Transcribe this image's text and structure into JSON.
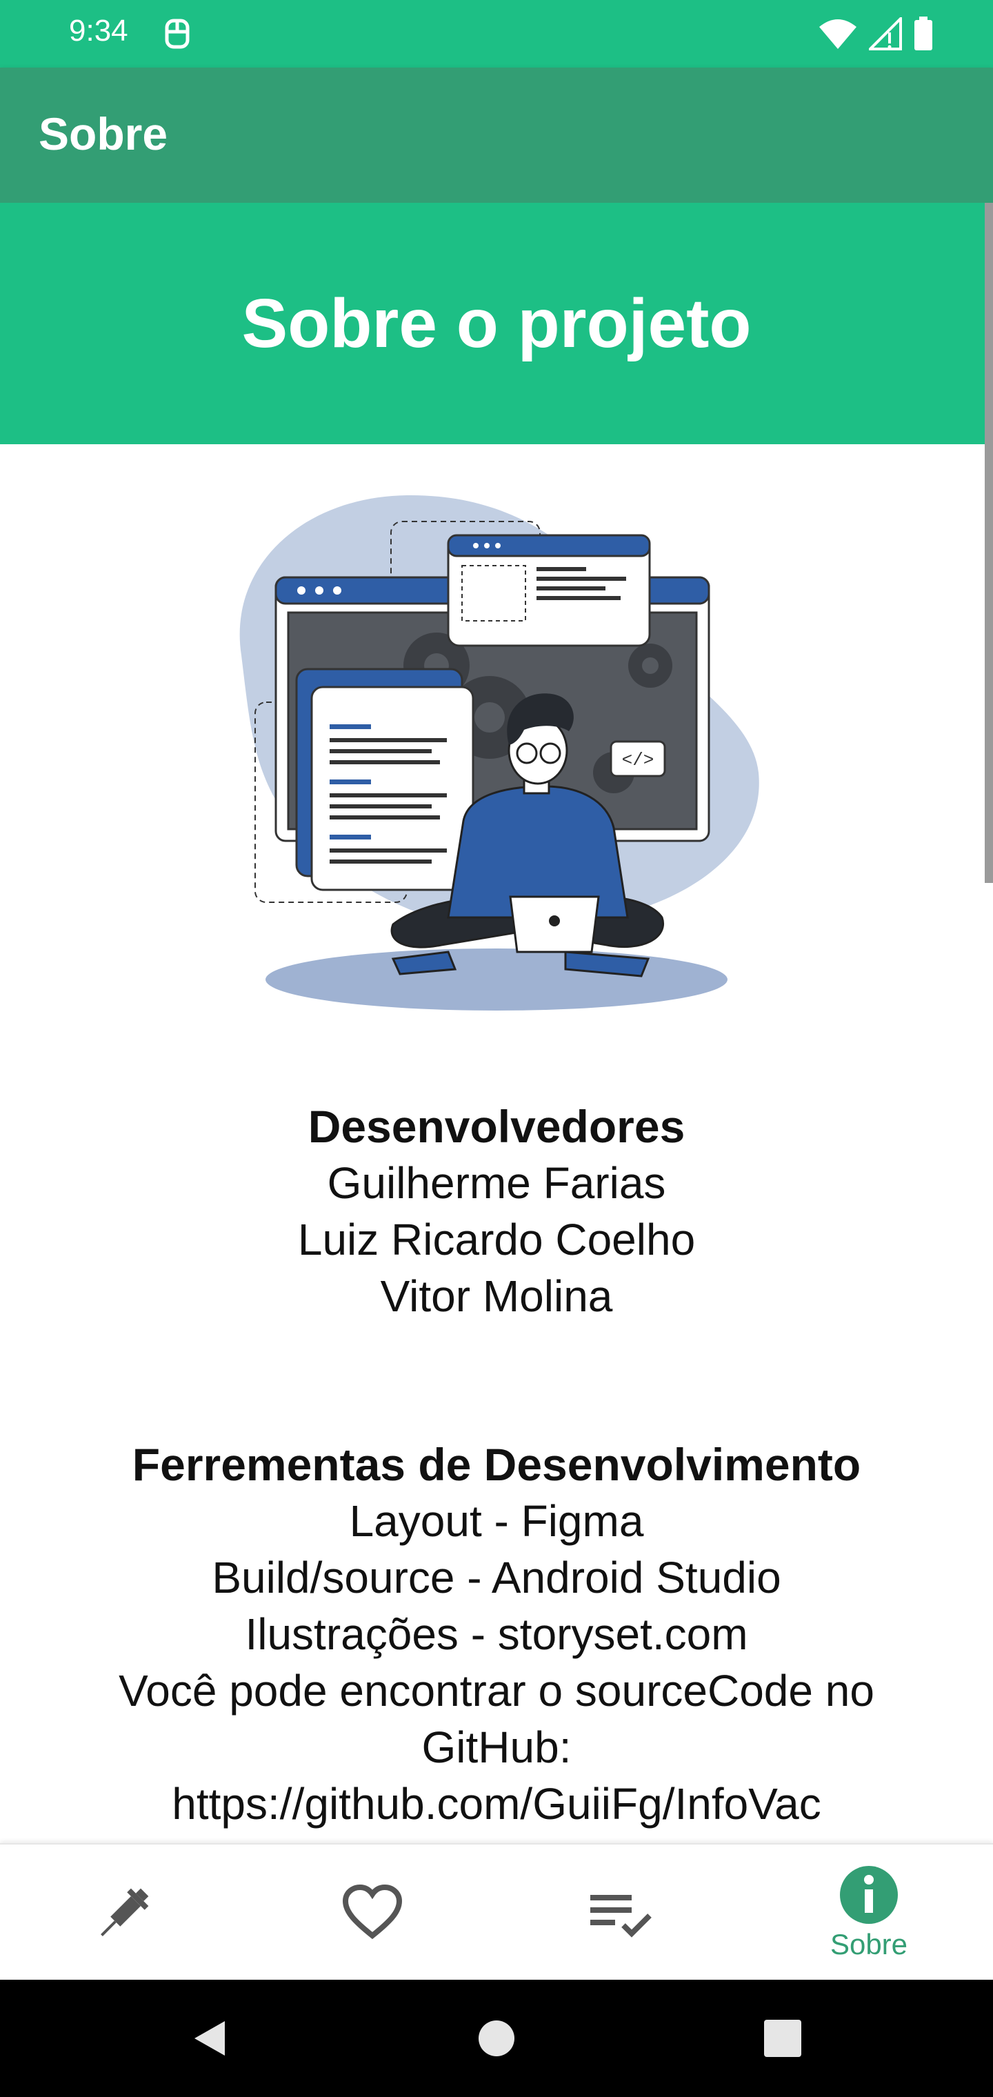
{
  "status_bar": {
    "time": "9:34",
    "icons": [
      "notification-icon",
      "wifi-icon",
      "signal-icon",
      "battery-icon"
    ]
  },
  "app_bar": {
    "title": "Sobre"
  },
  "banner": {
    "title": "Sobre o projeto"
  },
  "developers": {
    "heading": "Desenvolvedores",
    "names": [
      "Guilherme Farias",
      "Luiz Ricardo Coelho",
      "Vitor Molina"
    ]
  },
  "tools": {
    "heading": "Ferrementas de Desenvolvimento",
    "lines": [
      "Layout - Figma",
      "Build/source - Android Studio",
      "Ilustrações - storyset.com",
      "Você pode encontrar o sourceCode no",
      "GitHub:",
      "https://github.com/GuiiFg/InfoVac"
    ]
  },
  "bottom_nav": {
    "items": [
      {
        "icon": "syringe-icon",
        "label": ""
      },
      {
        "icon": "heart-icon",
        "label": ""
      },
      {
        "icon": "checklist-icon",
        "label": ""
      },
      {
        "icon": "info-icon",
        "label": "Sobre"
      }
    ],
    "active_color": "#339e74",
    "inactive_color": "#555555"
  },
  "colors": {
    "primary": "#1dbf85",
    "primary_dark": "#339e74"
  }
}
